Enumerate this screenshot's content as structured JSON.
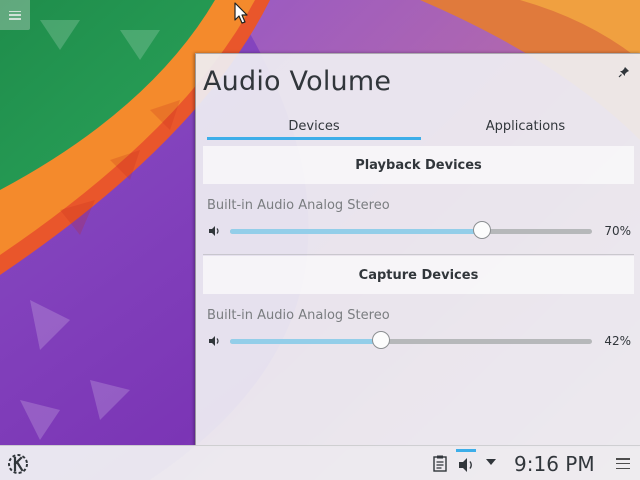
{
  "panel": {
    "title": "Audio Volume",
    "tabs": [
      {
        "label": "Devices",
        "active": true
      },
      {
        "label": "Applications",
        "active": false
      }
    ],
    "playback": {
      "header": "Playback Devices",
      "device_name": "Built-in Audio Analog Stereo",
      "volume_label": "70%",
      "volume": 0.7
    },
    "capture": {
      "header": "Capture Devices",
      "device_name": "Built-in Audio Analog Stereo",
      "volume_label": "42%",
      "volume": 0.42
    },
    "icons": {
      "pin": "pin-icon",
      "speaker": "speaker-icon"
    }
  },
  "taskbar": {
    "clock": "9:16 PM",
    "icons": [
      "kde-launcher-icon",
      "clipboard-icon",
      "volume-icon",
      "expand-arrow-icon",
      "panel-menu-icon"
    ]
  },
  "colors": {
    "accent": "#3daee9",
    "slider_fill": "#93cee9",
    "text": "#31363b"
  }
}
